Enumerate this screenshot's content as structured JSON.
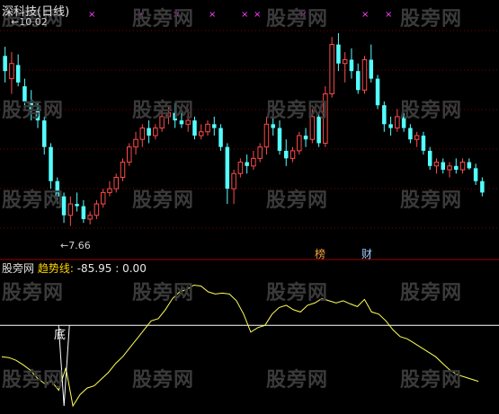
{
  "header": {
    "title": "深科技(日线)"
  },
  "watermark": "股旁网",
  "price_panel": {
    "high_label": "10.02",
    "low_label": "7.66",
    "events": [
      {
        "label": "榜",
        "color": "#f2a040"
      },
      {
        "label": "财",
        "color": "#9ad0ff"
      }
    ],
    "marker_symbol": "×",
    "colors": {
      "up": "#ff4a4a",
      "down": "#54ffff",
      "marker": "#ff40ff"
    }
  },
  "indicator_panel": {
    "source": "股旁网",
    "name": "趋势线:",
    "value": "-85.95",
    "zero": "0.00",
    "signal_label": "底",
    "colors": {
      "line": "#ffff55",
      "reference": "#ffffff"
    }
  },
  "chart_data": [
    {
      "type": "candlestick",
      "title": "深科技(日线)",
      "ylim": [
        7.3,
        10.4
      ],
      "candles": [
        [
          9.9,
          10.02,
          9.55,
          9.7
        ],
        [
          9.6,
          9.95,
          9.4,
          9.8
        ],
        [
          9.78,
          9.92,
          9.5,
          9.55
        ],
        [
          9.5,
          9.6,
          9.2,
          9.3
        ],
        [
          9.3,
          9.45,
          9.05,
          9.2
        ],
        [
          9.2,
          9.3,
          8.95,
          9.05
        ],
        [
          9.05,
          9.1,
          8.6,
          8.7
        ],
        [
          8.7,
          8.75,
          8.15,
          8.25
        ],
        [
          8.25,
          8.3,
          7.95,
          8.05
        ],
        [
          8.05,
          8.1,
          7.7,
          7.8
        ],
        [
          7.8,
          8.05,
          7.66,
          7.95
        ],
        [
          7.95,
          8.1,
          7.85,
          7.92
        ],
        [
          7.92,
          8.0,
          7.7,
          7.75
        ],
        [
          7.75,
          7.85,
          7.68,
          7.8
        ],
        [
          7.8,
          8.0,
          7.75,
          7.95
        ],
        [
          7.95,
          8.15,
          7.9,
          8.1
        ],
        [
          8.1,
          8.25,
          8.05,
          8.15
        ],
        [
          8.15,
          8.35,
          8.1,
          8.3
        ],
        [
          8.3,
          8.55,
          8.25,
          8.5
        ],
        [
          8.5,
          8.75,
          8.45,
          8.7
        ],
        [
          8.7,
          8.9,
          8.6,
          8.8
        ],
        [
          8.8,
          9.0,
          8.7,
          8.95
        ],
        [
          8.95,
          9.05,
          8.75,
          8.85
        ],
        [
          8.85,
          9.0,
          8.8,
          8.95
        ],
        [
          8.95,
          9.2,
          8.9,
          9.1
        ],
        [
          9.1,
          9.25,
          9.0,
          9.15
        ],
        [
          9.15,
          9.28,
          8.95,
          9.05
        ],
        [
          9.05,
          9.15,
          8.95,
          9.0
        ],
        [
          9.0,
          9.2,
          8.9,
          9.05
        ],
        [
          9.05,
          9.1,
          8.8,
          8.85
        ],
        [
          8.85,
          9.0,
          8.8,
          8.9
        ],
        [
          8.9,
          9.05,
          8.85,
          9.0
        ],
        [
          9.0,
          9.1,
          8.85,
          8.95
        ],
        [
          8.95,
          9.0,
          8.65,
          8.7
        ],
        [
          8.7,
          8.75,
          7.95,
          8.15
        ],
        [
          8.15,
          8.4,
          7.95,
          8.35
        ],
        [
          8.35,
          8.55,
          8.3,
          8.5
        ],
        [
          8.5,
          8.6,
          8.35,
          8.45
        ],
        [
          8.45,
          8.65,
          8.4,
          8.55
        ],
        [
          8.55,
          8.75,
          8.5,
          8.7
        ],
        [
          8.7,
          9.1,
          8.6,
          9.0
        ],
        [
          9.0,
          9.15,
          8.85,
          8.95
        ],
        [
          8.95,
          9.05,
          8.6,
          8.65
        ],
        [
          8.65,
          8.8,
          8.45,
          8.55
        ],
        [
          8.55,
          8.7,
          8.5,
          8.65
        ],
        [
          8.65,
          8.9,
          8.6,
          8.85
        ],
        [
          8.85,
          8.95,
          8.7,
          8.8
        ],
        [
          8.8,
          9.2,
          8.75,
          9.1
        ],
        [
          9.1,
          9.15,
          8.7,
          8.75
        ],
        [
          8.75,
          9.5,
          8.7,
          9.4
        ],
        [
          9.4,
          10.15,
          9.35,
          10.05
        ],
        [
          10.05,
          10.2,
          9.7,
          9.8
        ],
        [
          9.8,
          9.95,
          9.55,
          9.85
        ],
        [
          9.85,
          10.0,
          9.6,
          9.7
        ],
        [
          9.7,
          9.8,
          9.4,
          9.45
        ],
        [
          9.45,
          9.9,
          9.4,
          9.85
        ],
        [
          9.85,
          10.05,
          9.55,
          9.6
        ],
        [
          9.6,
          9.65,
          9.2,
          9.25
        ],
        [
          9.25,
          9.3,
          8.9,
          9.0
        ],
        [
          9.0,
          9.1,
          8.85,
          8.95
        ],
        [
          8.95,
          9.2,
          8.9,
          9.1
        ],
        [
          9.1,
          9.15,
          8.9,
          8.95
        ],
        [
          8.95,
          9.0,
          8.75,
          8.8
        ],
        [
          8.8,
          8.9,
          8.7,
          8.85
        ],
        [
          8.85,
          8.9,
          8.6,
          8.65
        ],
        [
          8.65,
          8.7,
          8.4,
          8.45
        ],
        [
          8.45,
          8.55,
          8.35,
          8.5
        ],
        [
          8.5,
          8.55,
          8.35,
          8.4
        ],
        [
          8.4,
          8.5,
          8.3,
          8.45
        ],
        [
          8.45,
          8.55,
          8.35,
          8.4
        ],
        [
          8.4,
          8.55,
          8.35,
          8.5
        ],
        [
          8.5,
          8.55,
          8.4,
          8.42
        ],
        [
          8.42,
          8.48,
          8.2,
          8.25
        ],
        [
          8.25,
          8.3,
          8.05,
          8.1
        ]
      ]
    },
    {
      "type": "line",
      "series": [
        {
          "name": "趋势线",
          "values": [
            -70,
            -72,
            -78,
            -88,
            -100,
            -118,
            -130,
            -125,
            -145,
            -95,
            -180,
            -155,
            -140,
            -135,
            -120,
            -105,
            -85,
            -70,
            -50,
            -30,
            -10,
            10,
            15,
            35,
            60,
            75,
            80,
            90,
            88,
            75,
            70,
            72,
            70,
            55,
            25,
            -15,
            -5,
            0,
            25,
            40,
            45,
            35,
            30,
            45,
            50,
            60,
            55,
            50,
            55,
            48,
            42,
            58,
            30,
            25,
            10,
            -10,
            -25,
            -30,
            -40,
            -50,
            -60,
            -70,
            -85,
            -100,
            -110,
            -115,
            -120,
            -125
          ]
        }
      ],
      "reference_level": 0,
      "signal_index": 9,
      "ylim": [
        -180,
        115
      ]
    }
  ]
}
